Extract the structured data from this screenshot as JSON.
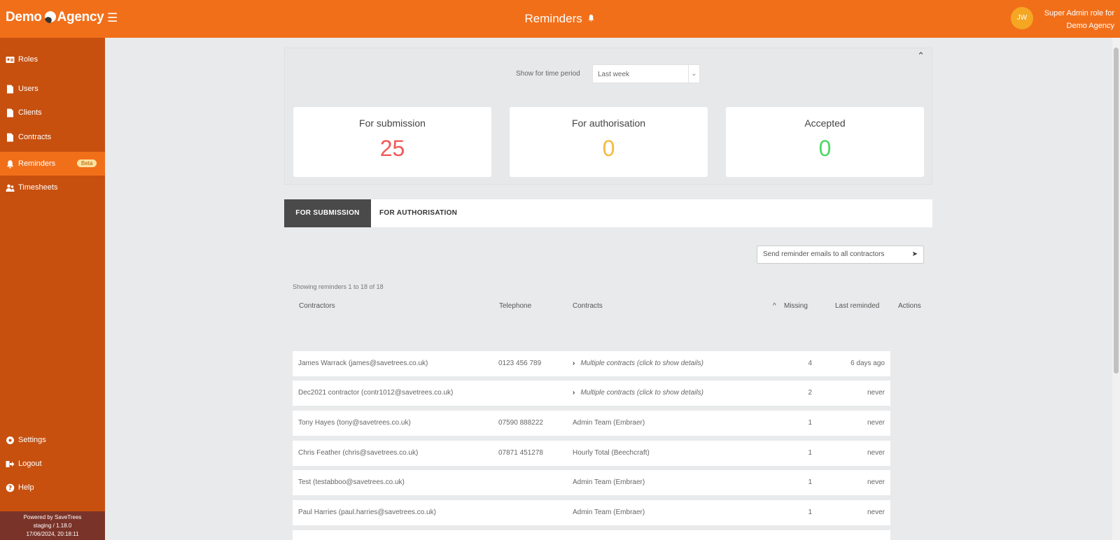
{
  "header": {
    "brand_part1": "Demo",
    "brand_part2": "Agency",
    "title": "Reminders",
    "avatar_initials": "JW",
    "role_line1": "Super Admin role for",
    "role_line2": "Demo Agency"
  },
  "sidebar": {
    "items": [
      {
        "label": "Roles",
        "icon": "id-card-icon"
      },
      {
        "label": "Users",
        "icon": "document-icon"
      },
      {
        "label": "Clients",
        "icon": "document-icon"
      },
      {
        "label": "Contracts",
        "icon": "document-icon"
      },
      {
        "label": "Reminders",
        "icon": "bell-icon",
        "badge": "Beta",
        "active": true
      },
      {
        "label": "Timesheets",
        "icon": "users-icon"
      }
    ],
    "bottom_items": [
      {
        "label": "Settings",
        "icon": "gear-icon"
      },
      {
        "label": "Logout",
        "icon": "logout-icon"
      },
      {
        "label": "Help",
        "icon": "help-icon"
      }
    ],
    "powered_line1": "Powered by SaveTrees",
    "powered_line2": "staging / 1.18.0",
    "powered_line3": "17/06/2024, 20:18:11"
  },
  "summary": {
    "period_label": "Show for time period",
    "period_value": "Last week",
    "cards": [
      {
        "label": "For submission",
        "value": "25",
        "color": "#f05a5a"
      },
      {
        "label": "For authorisation",
        "value": "0",
        "color": "#f5b942"
      },
      {
        "label": "Accepted",
        "value": "0",
        "color": "#4cd964"
      }
    ]
  },
  "tabs": [
    {
      "label": "FOR SUBMISSION",
      "active": true
    },
    {
      "label": "FOR AUTHORISATION",
      "active": false
    }
  ],
  "send_button_label": "Send reminder emails to all contractors",
  "showing_text": "Showing reminders 1 to 18 of 18",
  "table": {
    "headers": [
      "Contractors",
      "Telephone",
      "Contracts",
      "Missing",
      "Last reminded",
      "Actions"
    ],
    "sort_indicator": "^",
    "rows": [
      {
        "contractor": "James Warrack (james@savetrees.co.uk)",
        "telephone": "0123 456 789",
        "contracts": "Multiple contracts (click to show details)",
        "multi": true,
        "missing": "4",
        "last_reminded": "6 days ago"
      },
      {
        "contractor": "Dec2021 contractor (contr1012@savetrees.co.uk)",
        "telephone": "",
        "contracts": "Multiple contracts (click to show details)",
        "multi": true,
        "missing": "2",
        "last_reminded": "never"
      },
      {
        "contractor": "Tony Hayes (tony@savetrees.co.uk)",
        "telephone": "07590 888222",
        "contracts": "Admin Team (Embraer)",
        "multi": false,
        "missing": "1",
        "last_reminded": "never"
      },
      {
        "contractor": "Chris Feather (chris@savetrees.co.uk)",
        "telephone": "07871 451278",
        "contracts": "Hourly Total (Beechcraft)",
        "multi": false,
        "missing": "1",
        "last_reminded": "never"
      },
      {
        "contractor": "Test (testabboo@savetrees.co.uk)",
        "telephone": "",
        "contracts": "Admin Team (Embraer)",
        "multi": false,
        "missing": "1",
        "last_reminded": "never"
      },
      {
        "contractor": "Paul Harries (paul.harries@savetrees.co.uk)",
        "telephone": "",
        "contracts": "Admin Team (Embraer)",
        "multi": false,
        "missing": "1",
        "last_reminded": "never"
      }
    ]
  }
}
